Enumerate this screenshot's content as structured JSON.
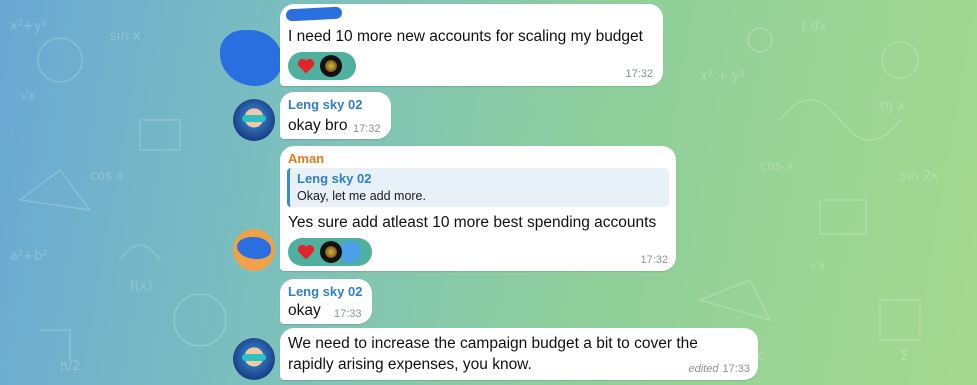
{
  "messages": [
    {
      "sender": "",
      "text": "I need 10 more new accounts for scaling my budget",
      "time": "17:32"
    },
    {
      "sender": "Leng sky 02",
      "text": "okay bro",
      "time": "17:32"
    },
    {
      "sender": "Aman",
      "reply_to": {
        "name": "Leng sky 02",
        "text": "Okay, let me add more."
      },
      "text": "Yes sure add atleast 10 more best spending accounts",
      "time": "17:32"
    },
    {
      "sender": "Leng sky 02",
      "text": "okay",
      "time": "17:33"
    },
    {
      "sender": "",
      "text": "We need to increase the campaign budget a bit to cover the rapidly arising expenses, you know.",
      "edited": "edited",
      "time": "17:33"
    }
  ],
  "colors": {
    "leng_name": "#2f7fc6",
    "aman_name": "#e07b1a",
    "reaction_bg": "#4fb0a0",
    "heart": "#e0262b"
  },
  "icons": [
    "heart-icon",
    "reaction-avatar",
    "avatar"
  ]
}
